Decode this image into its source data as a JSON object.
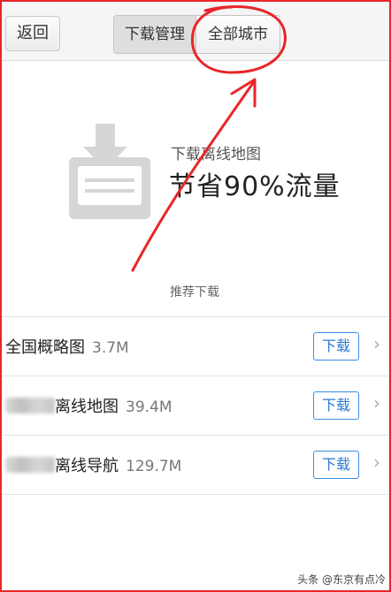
{
  "header": {
    "back_label": "返回",
    "tabs": [
      {
        "label": "下载管理",
        "active": true
      },
      {
        "label": "全部城市",
        "active": false
      }
    ]
  },
  "hero": {
    "icon": "download-tray-icon",
    "subtitle": "下载离线地图",
    "headline": "节省90%流量"
  },
  "recommend": {
    "title": "推荐下载",
    "items": [
      {
        "name": "全国概略图",
        "size": "3.7M",
        "button": "下载"
      },
      {
        "name": "离线地图",
        "size": "39.4M",
        "button": "下载"
      },
      {
        "name": "离线导航",
        "size": "129.7M",
        "button": "下载"
      }
    ]
  },
  "watermark": "头条 @东京有点冷",
  "colors": {
    "annotation": "#e8262a",
    "accent": "#2a7ad6"
  }
}
